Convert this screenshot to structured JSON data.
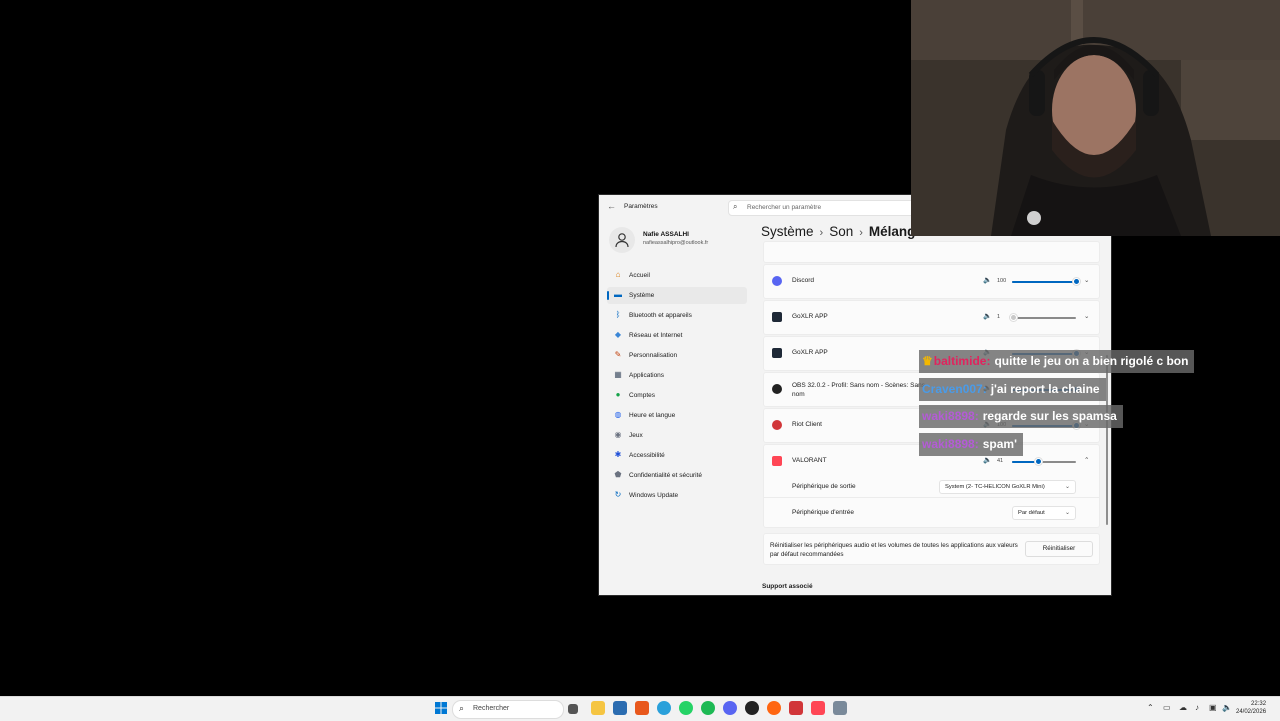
{
  "window": {
    "back_icon": "back-arrow-icon",
    "title": "Paramètres",
    "search_placeholder": "Rechercher un paramètre"
  },
  "user": {
    "name": "Nafie ASSALHI",
    "email": "nafieassalhipro@outlook.fr"
  },
  "sidebar": {
    "items": [
      {
        "label": "Accueil",
        "icon": "home-icon",
        "color": "#d97706"
      },
      {
        "label": "Système",
        "icon": "system-icon",
        "color": "#0067c0",
        "selected": true
      },
      {
        "label": "Bluetooth et appareils",
        "icon": "bluetooth-icon",
        "color": "#0067c0"
      },
      {
        "label": "Réseau et Internet",
        "icon": "wifi-icon",
        "color": "#3a86d6"
      },
      {
        "label": "Personnalisation",
        "icon": "brush-icon",
        "color": "#c2410c"
      },
      {
        "label": "Applications",
        "icon": "apps-icon",
        "color": "#475569"
      },
      {
        "label": "Comptes",
        "icon": "account-icon",
        "color": "#16a34a"
      },
      {
        "label": "Heure et langue",
        "icon": "globe-icon",
        "color": "#2563eb"
      },
      {
        "label": "Jeux",
        "icon": "gamepad-icon",
        "color": "#6b7280"
      },
      {
        "label": "Accessibilité",
        "icon": "accessibility-icon",
        "color": "#1d4ed8"
      },
      {
        "label": "Confidentialité et sécurité",
        "icon": "shield-icon",
        "color": "#6b7280"
      },
      {
        "label": "Windows Update",
        "icon": "update-icon",
        "color": "#0067c0"
      }
    ]
  },
  "breadcrumb": {
    "part1": "Système",
    "part2": "Son",
    "current": "Mélangeur de volume"
  },
  "apps": [
    {
      "name": "Discord",
      "volume": "100",
      "level": 100,
      "icon": "discord-icon",
      "color": "#5865f2"
    },
    {
      "name": "GoXLR APP",
      "volume": "1",
      "level": 1,
      "icon": "goxlr-icon",
      "color": "#1f2937"
    },
    {
      "name": "GoXLR APP",
      "volume": "",
      "level": 100,
      "icon": "goxlr-icon",
      "color": "#1f2937"
    },
    {
      "name": "OBS 32.0.2 - Profil: Sans nom - Scènes: Sans nom",
      "volume": "",
      "level": 100,
      "icon": "obs-icon",
      "color": "#222222"
    },
    {
      "name": "Riot Client",
      "volume": "100",
      "level": 100,
      "icon": "riot-icon",
      "color": "#d13639"
    },
    {
      "name": "VALORANT",
      "volume": "41",
      "level": 41,
      "icon": "valorant-icon",
      "color": "#ff4655"
    }
  ],
  "valorant_details": {
    "output_label": "Périphérique de sortie",
    "output_value": "System (2- TC-HELICON GoXLR Mini)",
    "input_label": "Périphérique d'entrée",
    "input_value": "Par défaut"
  },
  "reset": {
    "text": "Réinitialiser les périphériques audio et les volumes de toutes les applications aux valeurs par défaut recommandées",
    "button": "Réinitialiser"
  },
  "support": "Support associé",
  "chat": [
    {
      "user": "baltimide",
      "message": "quitte le jeu on a bien rigolé c bon",
      "color": "#e0245e",
      "badge": "crown-icon"
    },
    {
      "user": "Craven007",
      "message": "j'ai report la chaine",
      "color": "#4a9be8"
    },
    {
      "user": "waki8898",
      "message": "regarde sur les spamsa",
      "color": "#b45bd6"
    },
    {
      "user": "waki8898",
      "message": "spam'",
      "color": "#b45bd6"
    }
  ],
  "taskbar": {
    "search_placeholder": "Rechercher",
    "time": "22:32",
    "date": "24/02/2026"
  }
}
